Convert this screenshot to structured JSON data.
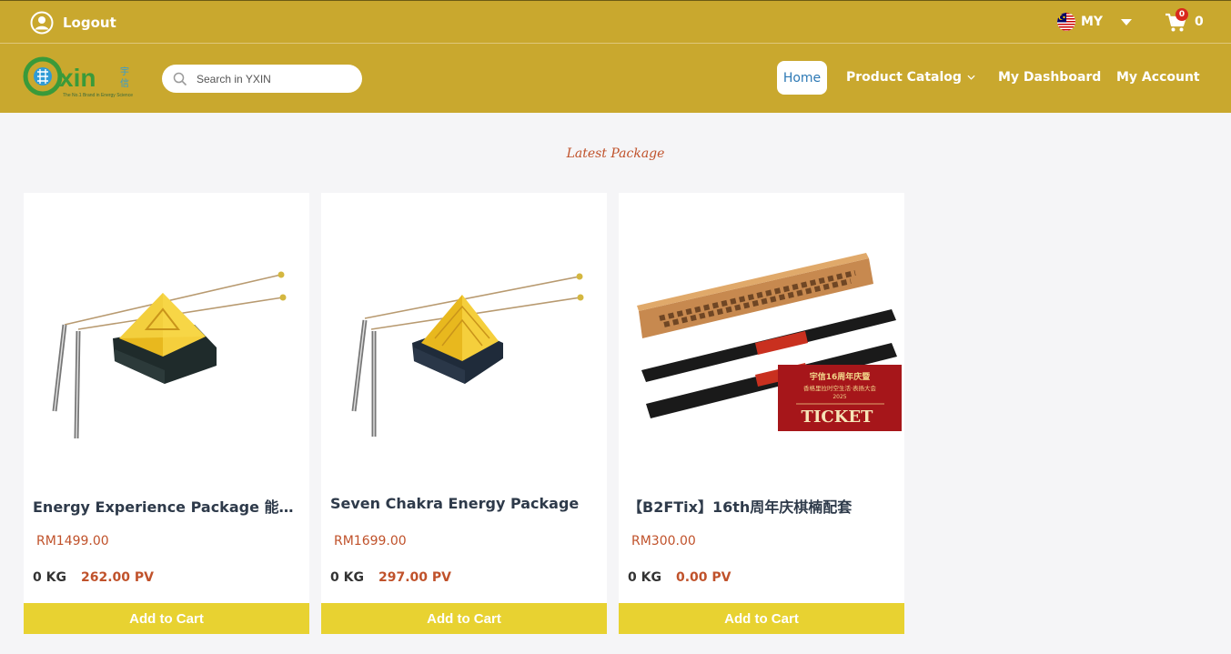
{
  "topbar": {
    "logout_label": "Logout",
    "country": "MY",
    "cart_badge": "0",
    "cart_count": "0"
  },
  "nav": {
    "search_placeholder": "Search in YXIN",
    "home": "Home",
    "product_catalog": "Product Catalog",
    "my_dashboard": "My Dashboard",
    "my_account": "My Account"
  },
  "logo": {
    "brand": "xin",
    "chinese": "宇信",
    "tagline": "The No.1 Brand in Energy Science"
  },
  "section_title": "Latest Package",
  "products": [
    {
      "name": "Energy Experience Package 能量体验配套",
      "price": "RM1499.00",
      "weight": "0 KG",
      "pv": "262.00 PV",
      "button": "Add to Cart"
    },
    {
      "name": "Seven Chakra Energy Package",
      "price": "RM1699.00",
      "weight": "0 KG",
      "pv": "297.00 PV",
      "button": "Add to Cart"
    },
    {
      "name": "【B2FTix】16th周年庆棋楠配套",
      "price": "RM300.00",
      "weight": "0 KG",
      "pv": "0.00 PV",
      "button": "Add to Cart",
      "ticket": {
        "line1": "宇信16周年庆暨",
        "line2": "香格里拉时空生活·表扬大会",
        "year": "2025",
        "label": "TICKET"
      }
    }
  ],
  "colors": {
    "gold": "#c9a82e",
    "button": "#e8d231",
    "accent": "#c0522b",
    "home_text": "#2d79b5"
  },
  "icons": [
    "user-circle-icon",
    "malaysia-flag-icon",
    "caret-down-icon",
    "cart-icon",
    "search-icon",
    "chevron-down-icon"
  ]
}
